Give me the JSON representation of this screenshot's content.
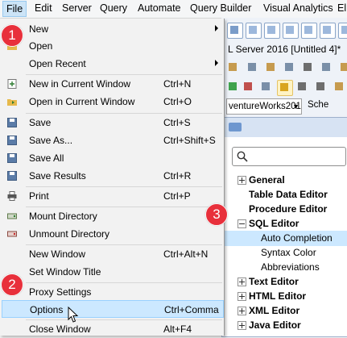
{
  "menubar": [
    "File",
    "Edit",
    "Server",
    "Query",
    "Automate",
    "Query Builder",
    "Visual Analytics",
    "El"
  ],
  "background": {
    "tab_title": "L Server 2016 [Untitled 4]*",
    "database": "ventureWorks2012",
    "schema_label": "Sche"
  },
  "file_menu": [
    {
      "label": "New",
      "shortcut": "",
      "submenu": true,
      "icon": ""
    },
    {
      "label": "Open",
      "shortcut": "",
      "submenu": false,
      "icon": "open-folder-icon"
    },
    {
      "label": "Open Recent",
      "shortcut": "",
      "submenu": true,
      "icon": ""
    },
    {
      "label": "New in Current Window",
      "shortcut": "Ctrl+N",
      "submenu": false,
      "icon": "new-doc-icon"
    },
    {
      "label": "Open in Current Window",
      "shortcut": "Ctrl+O",
      "submenu": false,
      "icon": "open-in-window-icon"
    },
    {
      "label": "Save",
      "shortcut": "Ctrl+S",
      "submenu": false,
      "icon": "save-icon"
    },
    {
      "label": "Save As...",
      "shortcut": "Ctrl+Shift+S",
      "submenu": false,
      "icon": "save-as-icon"
    },
    {
      "label": "Save All",
      "shortcut": "",
      "submenu": false,
      "icon": "save-all-icon"
    },
    {
      "label": "Save Results",
      "shortcut": "Ctrl+R",
      "submenu": false,
      "icon": "save-results-icon"
    },
    {
      "label": "Print",
      "shortcut": "Ctrl+P",
      "submenu": false,
      "icon": "print-icon"
    },
    {
      "label": "Mount Directory",
      "shortcut": "",
      "submenu": false,
      "icon": "mount-directory-icon"
    },
    {
      "label": "Unmount Directory",
      "shortcut": "",
      "submenu": false,
      "icon": "unmount-directory-icon"
    },
    {
      "label": "New Window",
      "shortcut": "Ctrl+Alt+N",
      "submenu": false,
      "icon": ""
    },
    {
      "label": "Set Window Title",
      "shortcut": "",
      "submenu": false,
      "icon": ""
    },
    {
      "label": "Proxy Settings",
      "shortcut": "",
      "submenu": false,
      "icon": ""
    },
    {
      "label": "Options",
      "shortcut": "Ctrl+Comma",
      "submenu": false,
      "icon": ""
    },
    {
      "label": "Close Window",
      "shortcut": "Alt+F4",
      "submenu": false,
      "icon": ""
    }
  ],
  "options_tree": [
    {
      "label": "General",
      "level": 0,
      "expander": "plus"
    },
    {
      "label": "Table Data Editor",
      "level": 0,
      "expander": ""
    },
    {
      "label": "Procedure Editor",
      "level": 0,
      "expander": ""
    },
    {
      "label": "SQL Editor",
      "level": 0,
      "expander": "minus"
    },
    {
      "label": "Auto Completion",
      "level": 1,
      "expander": "",
      "selected": true
    },
    {
      "label": "Syntax Color",
      "level": 1,
      "expander": ""
    },
    {
      "label": "Abbreviations",
      "level": 1,
      "expander": ""
    },
    {
      "label": "Text Editor",
      "level": 0,
      "expander": "plus"
    },
    {
      "label": "HTML Editor",
      "level": 0,
      "expander": "plus"
    },
    {
      "label": "XML Editor",
      "level": 0,
      "expander": "plus"
    },
    {
      "label": "Java Editor",
      "level": 0,
      "expander": "plus"
    }
  ],
  "badges": [
    "1",
    "2",
    "3"
  ],
  "colors": {
    "badge": "#e8303b",
    "highlight": "#cce8ff",
    "tree_selected": "#cce8ff"
  }
}
